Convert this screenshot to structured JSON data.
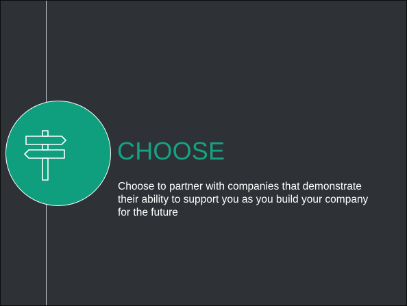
{
  "slide": {
    "title": "CHOOSE",
    "body": "Choose to partner with companies that demonstrate their ability to support you as you build your company for the future",
    "icon": "signpost-icon",
    "colors": {
      "background": "#2e3136",
      "accent": "#0f9e7e",
      "title": "#16a384",
      "text": "#ffffff"
    }
  }
}
